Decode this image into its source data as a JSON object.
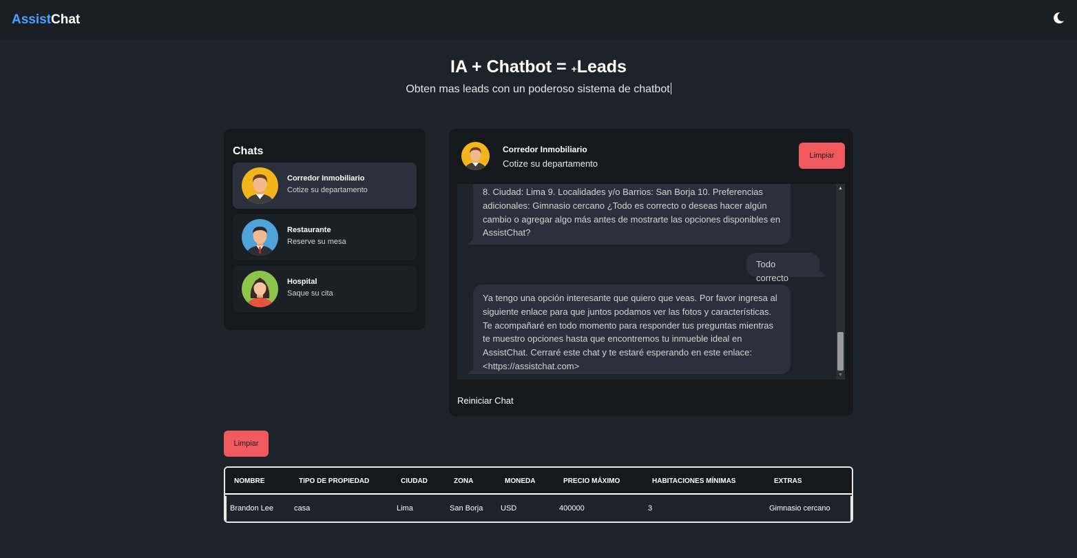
{
  "navbar": {
    "brand_part1": "Assist",
    "brand_part2": "Chat",
    "theme_icon": "moon-icon"
  },
  "hero": {
    "title_main": "IA + Chatbot = ",
    "title_plus": "+",
    "title_end": "Leads",
    "subtitle": "Obten mas leads con un poderoso sistema de chatbot"
  },
  "sidebar": {
    "title": "Chats",
    "items": [
      {
        "name": "Corredor Inmobiliario",
        "desc": "Cotize su departamento",
        "icon": "realtor-avatar-icon"
      },
      {
        "name": "Restaurante",
        "desc": "Reserve su mesa",
        "icon": "waiter-avatar-icon"
      },
      {
        "name": "Hospital",
        "desc": "Saque su cita",
        "icon": "doctor-avatar-icon"
      }
    ]
  },
  "chat": {
    "header_name": "Corredor Inmobiliario",
    "header_desc": "Cotize su departamento",
    "clear_label": "Limpiar",
    "restart_label": "Reiniciar Chat",
    "messages": [
      {
        "from": "bot",
        "text": "8. Ciudad: Lima 9. Localidades y/o Barrios: San Borja 10. Preferencias adicionales: Gimnasio cercano ¿Todo es correcto o deseas hacer algún cambio o agregar algo más antes de mostrarte las opciones disponibles en AssistChat?"
      },
      {
        "from": "user",
        "text": "Todo correcto"
      },
      {
        "from": "bot",
        "text": "Ya tengo una opción interesante que quiero que veas. Por favor ingresa al siguiente enlace para que juntos podamos ver las fotos y características. Te acompañaré en todo momento para responder tus preguntas mientras te muestro opciones hasta que encontremos tu inmueble ideal en AssistChat. Cerraré este chat y te estaré esperando en este enlace: <https://assistchat.com>"
      }
    ]
  },
  "leads": {
    "clear_label": "Limpiar",
    "columns": [
      "NOMBRE",
      "TIPO DE PROPIEDAD",
      "CIUDAD",
      "ZONA",
      "MONEDA",
      "PRECIO MÁXIMO",
      "HABITACIONES MÍNIMAS",
      "EXTRAS"
    ],
    "rows": [
      [
        "Brandon Lee",
        "casa",
        "Lima",
        "San Borja",
        "USD",
        "400000",
        "3",
        "Gimnasio cercano"
      ]
    ]
  },
  "colors": {
    "accent_blue": "#4aa3ff",
    "button_red": "#f05a5f",
    "background": "#1d232a",
    "panel": "#15191e",
    "bubble": "#2a313c"
  }
}
